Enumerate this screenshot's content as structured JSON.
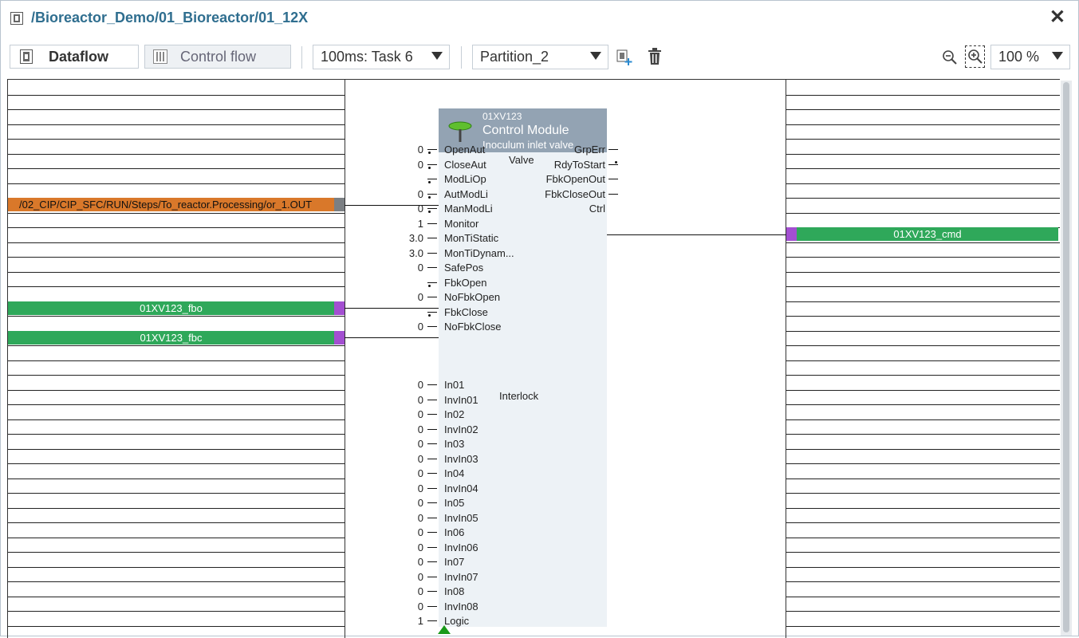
{
  "window": {
    "title": "/Bioreactor_Demo/01_Bioreactor/01_12X",
    "close_glyph": "✕"
  },
  "toolbar": {
    "dataflow_label": "Dataflow",
    "controlflow_label": "Control flow",
    "task_select": "100ms: Task 6",
    "partition_select": "Partition_2",
    "zoom_select": "100 %",
    "icons": [
      "dataflow-icon",
      "controlflow-icon",
      "add-partition-icon",
      "delete-icon",
      "zoom-out-icon",
      "zoom-in-icon"
    ]
  },
  "colors": {
    "accent": "#2f6e8f",
    "variable_green": "#2fa85a",
    "variable_orange": "#d9782a",
    "pin_purple": "#a34fd1",
    "module_header": "#93a3b3",
    "module_body": "#edf2f6"
  },
  "left_vars": {
    "orange": "/02_CIP/CIP_SFC/RUN/Steps/To_reactor.Processing/or_1.OUT",
    "fbo": "01XV123_fbo",
    "fbc": "01XV123_fbc"
  },
  "right_vars": {
    "cmd": "01XV123_cmd"
  },
  "module": {
    "id": "01XV123",
    "name": "Control Module",
    "description": "Inoculum inlet valve",
    "valve_section": "Valve",
    "interlock_section": "Interlock",
    "inputs": [
      {
        "val": "0",
        "label": "OpenAut"
      },
      {
        "val": "0",
        "label": "CloseAut"
      },
      {
        "val": "",
        "label": "ModLiOp"
      },
      {
        "val": "0",
        "label": "AutModLi"
      },
      {
        "val": "0",
        "label": "ManModLi"
      },
      {
        "val": "1",
        "label": "Monitor"
      },
      {
        "val": "3.0",
        "label": "MonTiStatic"
      },
      {
        "val": "3.0",
        "label": "MonTiDynam..."
      },
      {
        "val": "0",
        "label": "SafePos"
      },
      {
        "val": "",
        "label": "FbkOpen"
      },
      {
        "val": "0",
        "label": "NoFbkOpen"
      },
      {
        "val": "",
        "label": "FbkClose"
      },
      {
        "val": "0",
        "label": "NoFbkClose"
      }
    ],
    "outputs": [
      "GrpErr",
      "RdyToStart",
      "FbkOpenOut",
      "FbkCloseOut",
      "Ctrl"
    ],
    "interlock_inputs": [
      {
        "val": "0",
        "label": "In01"
      },
      {
        "val": "0",
        "label": "InvIn01"
      },
      {
        "val": "0",
        "label": "In02"
      },
      {
        "val": "0",
        "label": "InvIn02"
      },
      {
        "val": "0",
        "label": "In03"
      },
      {
        "val": "0",
        "label": "InvIn03"
      },
      {
        "val": "0",
        "label": "In04"
      },
      {
        "val": "0",
        "label": "InvIn04"
      },
      {
        "val": "0",
        "label": "In05"
      },
      {
        "val": "0",
        "label": "InvIn05"
      },
      {
        "val": "0",
        "label": "In06"
      },
      {
        "val": "0",
        "label": "InvIn06"
      },
      {
        "val": "0",
        "label": "In07"
      },
      {
        "val": "0",
        "label": "InvIn07"
      },
      {
        "val": "0",
        "label": "In08"
      },
      {
        "val": "0",
        "label": "InvIn08"
      },
      {
        "val": "1",
        "label": "Logic"
      }
    ]
  }
}
